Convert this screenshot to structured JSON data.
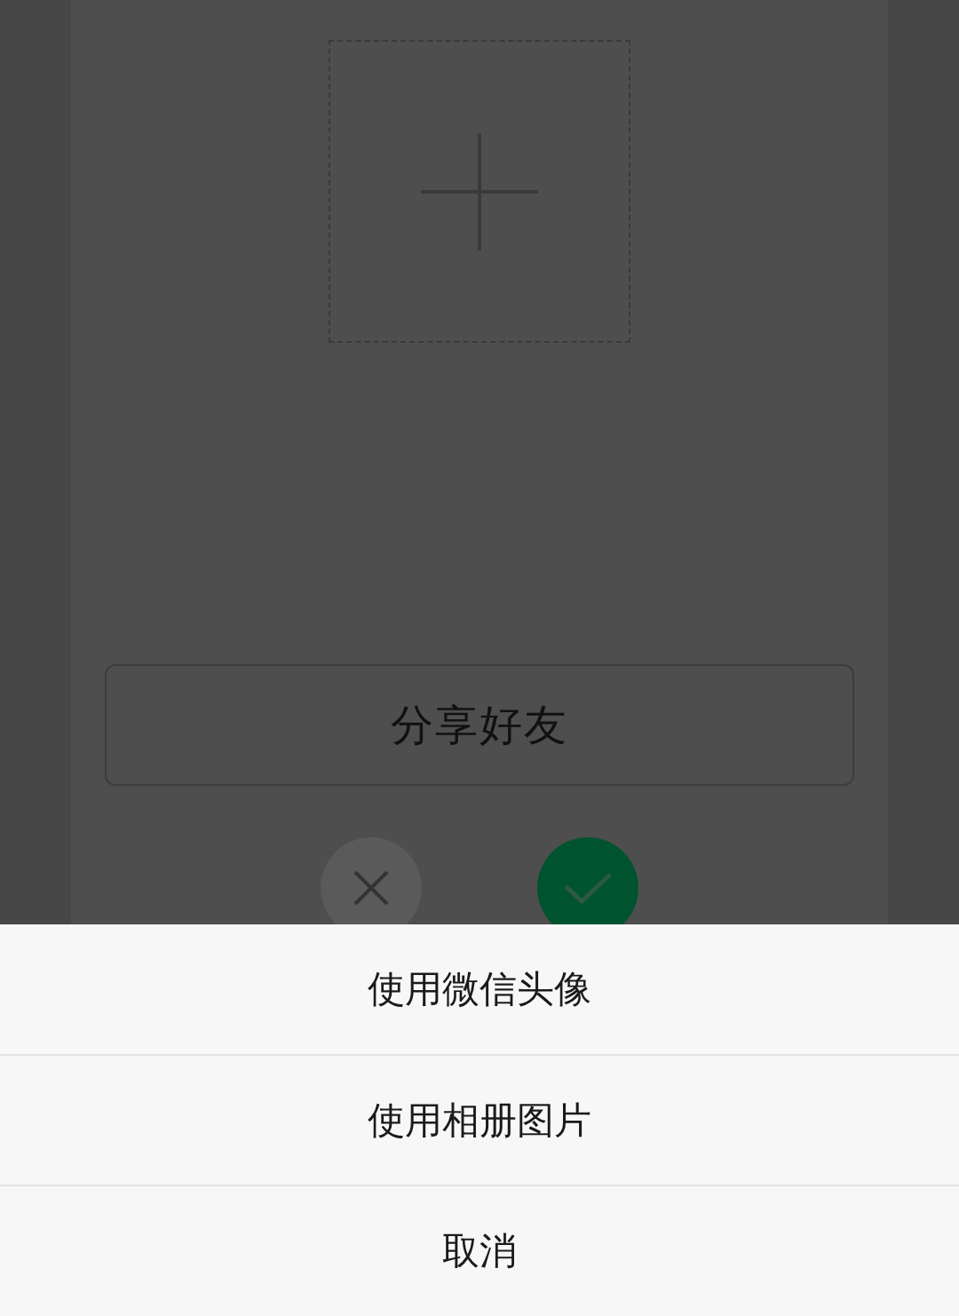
{
  "share_button": {
    "label": "分享好友"
  },
  "action_sheet": {
    "options": [
      {
        "label": "使用微信头像"
      },
      {
        "label": "使用相册图片"
      },
      {
        "label": "取消"
      }
    ]
  }
}
